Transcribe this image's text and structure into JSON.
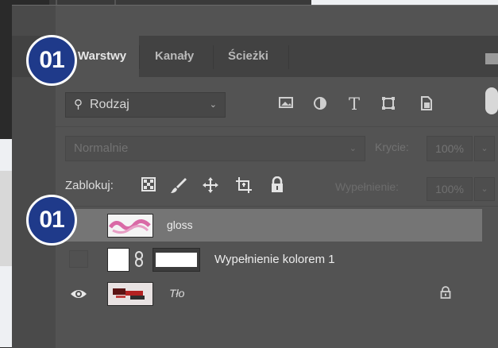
{
  "tabs": [
    {
      "label": "Warstwy",
      "active": true
    },
    {
      "label": "Kanały",
      "active": false
    },
    {
      "label": "Ścieżki",
      "active": false
    }
  ],
  "filter": {
    "label": "Rodzaj",
    "icon": "search-icon"
  },
  "filter_icons": [
    "image-filter-icon",
    "adjustment-filter-icon",
    "type-filter-icon",
    "shape-filter-icon",
    "smart-object-filter-icon"
  ],
  "blend": {
    "value": "Normalnie",
    "opacity_label": "Krycie:",
    "opacity_value": "100%"
  },
  "lock": {
    "label": "Zablokuj:",
    "icons": [
      "lock-transparent-icon",
      "lock-brush-icon",
      "lock-move-icon",
      "lock-artboard-icon",
      "lock-all-icon"
    ],
    "fill_label": "Wypełnienie:",
    "fill_value": "100%"
  },
  "layers": [
    {
      "name": "gloss",
      "selected": true,
      "visible": false
    },
    {
      "name": "Wypełnienie kolorem 1",
      "selected": false,
      "visible": false
    },
    {
      "name": "Tło",
      "selected": false,
      "visible": true,
      "locked": true
    }
  ],
  "badges": [
    "01",
    "01"
  ],
  "colors": {
    "panel": "#535353",
    "selected_row": "#757575",
    "badge": "#1f3a8a"
  }
}
